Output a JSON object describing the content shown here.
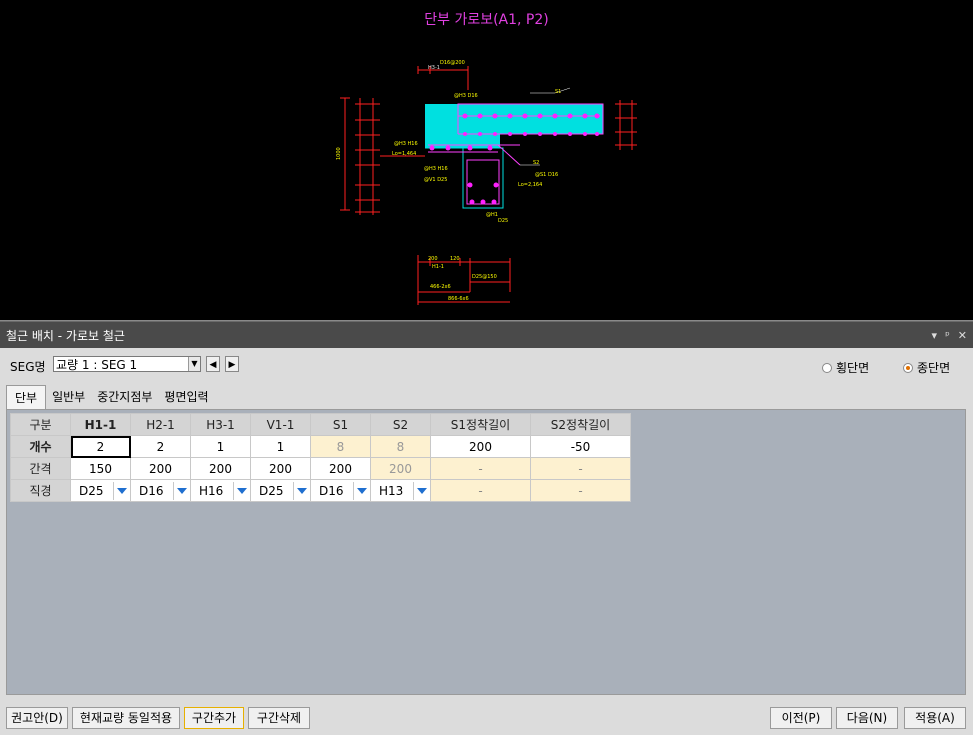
{
  "drawing": {
    "title": "단부 가로보(A1, P2)"
  },
  "panel": {
    "title": "철근 배치 - 가로보 철근",
    "controls": {
      "dropdown": "▾",
      "pin": "ᵖ",
      "close": "✕"
    }
  },
  "seg": {
    "label": "SEG명",
    "value": "교량 1 : SEG 1",
    "prev": "◀",
    "next": "▶"
  },
  "section_radio": {
    "options": [
      {
        "label": "횡단면",
        "selected": false
      },
      {
        "label": "종단면",
        "selected": true
      }
    ]
  },
  "tabs": [
    {
      "label": "단부",
      "active": true
    },
    {
      "label": "일반부",
      "active": false
    },
    {
      "label": "중간지점부",
      "active": false
    },
    {
      "label": "평면입력",
      "active": false
    }
  ],
  "grid": {
    "corner": "구분",
    "columns": [
      "H1-1",
      "H2-1",
      "H3-1",
      "V1-1",
      "S1",
      "S2",
      "S1정착길이",
      "S2정착길이"
    ],
    "rows": [
      {
        "label": "개수",
        "values": [
          "2",
          "2",
          "1",
          "1",
          "8",
          "8",
          "200",
          "-50"
        ]
      },
      {
        "label": "간격",
        "values": [
          "150",
          "200",
          "200",
          "200",
          "200",
          "200",
          "-",
          "-"
        ]
      },
      {
        "label": "직경",
        "values": [
          "D25",
          "D16",
          "H16",
          "D25",
          "D16",
          "H13",
          "-",
          "-"
        ]
      }
    ]
  },
  "buttons": {
    "recommend": "권고안(D)",
    "apply_same": "현재교량 동일적용",
    "add_section": "구간추가",
    "delete_section": "구간삭제",
    "prev": "이전(P)",
    "next": "다음(N)",
    "apply": "적용(A)"
  },
  "colors": {
    "drawing_bg": "#000000",
    "title": "#e040e0",
    "disabled_cell": "#fdf1d0",
    "grid_bg": "#a9b0ba"
  }
}
